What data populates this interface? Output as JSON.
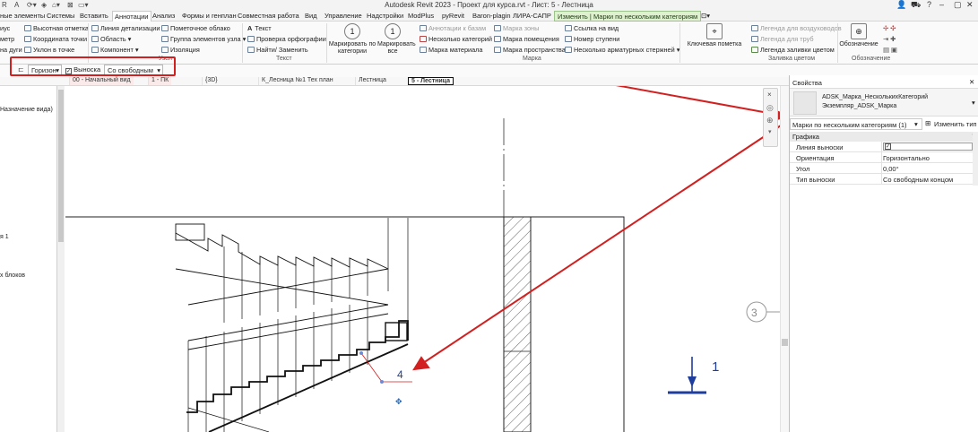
{
  "window": {
    "title": "Autodesk Revit 2023 - Проект для курса.rvt - Лист: 5 - Лестница"
  },
  "tabs": [
    {
      "label": "ные элементы"
    },
    {
      "label": "Системы"
    },
    {
      "label": "Вставить"
    },
    {
      "label": "Аннотации"
    },
    {
      "label": "Анализ"
    },
    {
      "label": "Формы и генплан"
    },
    {
      "label": "Совместная работа"
    },
    {
      "label": "Вид"
    },
    {
      "label": "Управление"
    },
    {
      "label": "Надстройки"
    },
    {
      "label": "ModPlus"
    },
    {
      "label": "pyRevit"
    },
    {
      "label": "Baron-plagin"
    },
    {
      "label": "ЛИРА-САПР"
    },
    {
      "label": "Изменить | Марки по нескольким категориям"
    }
  ],
  "ribbon": {
    "dim": [
      "иус",
      "метр",
      "на дуги"
    ],
    "spot": [
      "Высотная отметка",
      "Координата точки",
      "Уклон в точке"
    ],
    "detail": [
      "Линия детализации",
      "Область",
      "Компонент"
    ],
    "detail2": [
      "Пометочное облако",
      "Группа элементов узла",
      "Изоляция"
    ],
    "detail_panel": "Узел",
    "text": [
      "Текст",
      "Проверка орфографии",
      "Найти/ Заменить"
    ],
    "text_panel": "Текст",
    "tag_by_category": "Маркировать по категории",
    "tag_all": "Маркировать все",
    "tag_col1": [
      "Аннотации к базам",
      "Несколько категорий",
      "Марка материала"
    ],
    "tag_col2": [
      "Марка зоны",
      "Марка помещения",
      "Марка пространства"
    ],
    "tag_col3": [
      "Ссылка на вид",
      "Номер ступени",
      "Несколько арматурных стержней"
    ],
    "tag_panel": "Марка",
    "keynote": "Ключевая пометка",
    "legends": [
      "Легенда для воздуховодов",
      "Легенда для труб",
      "Легенда заливки цветом"
    ],
    "color_panel": "Заливка цветом",
    "symbol": "Обозначение",
    "symbol_panel": "Обозначение"
  },
  "options_bar": {
    "orientation": "Горизон",
    "leader_label": "Выноска",
    "leader_type": "Со свободным"
  },
  "view_tabs": [
    {
      "label": "00 - Начальный вид"
    },
    {
      "label": "1 - ПК"
    },
    {
      "label": "{3D}"
    },
    {
      "label": "К_Лесница №1 Тех план"
    },
    {
      "label": "Лестница"
    },
    {
      "label": "5 - Лестница"
    }
  ],
  "browser": {
    "items": [
      "Назначение вида)",
      "я 1",
      "х блоков"
    ]
  },
  "drawing": {
    "tag_value": "4",
    "section_number": "1",
    "grid_bubble": "3"
  },
  "properties": {
    "header": "Свойства",
    "type_name_line1": "ADSK_Марка_НесколькихКатегорий",
    "type_name_line2": "Экземпляр_ADSK_Марка",
    "selector": "Марки по нескольким категориям (1)",
    "edit_type": "Изменить тип",
    "group": "Графика",
    "rows": [
      {
        "key": "Линия выноски",
        "value": ""
      },
      {
        "key": "Ориентация",
        "value": "Горизонтально"
      },
      {
        "key": "Угол",
        "value": "0,00°"
      },
      {
        "key": "Тип выноски",
        "value": "Со свободным концом"
      }
    ]
  },
  "colors": {
    "annotation_red": "#d21f1f",
    "tag_blue": "#1f3d9c",
    "context_tab": "#dff0d0"
  }
}
